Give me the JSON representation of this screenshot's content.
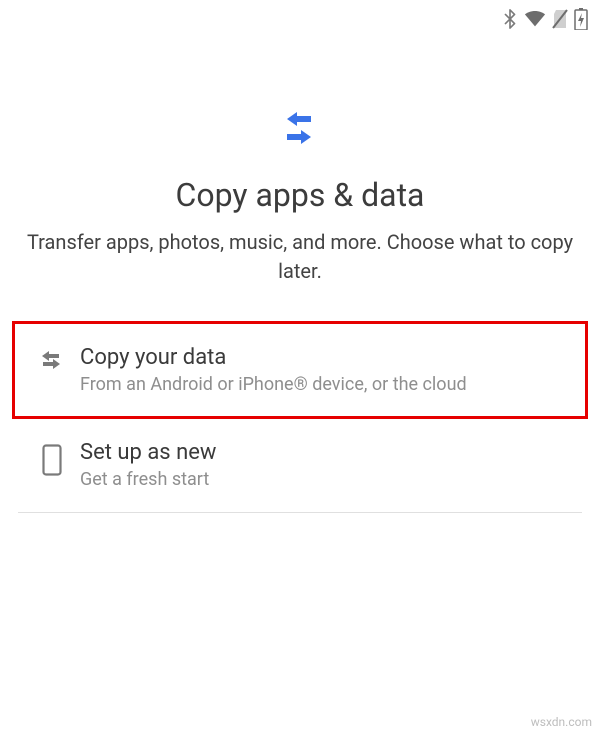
{
  "status_icons": {
    "bluetooth": "bluetooth-icon",
    "wifi": "wifi-icon",
    "no_sim": "no-sim-icon",
    "battery": "battery-charging-icon"
  },
  "hero": {
    "title": "Copy apps & data",
    "subtitle": "Transfer apps, photos, music, and more. Choose what to copy later."
  },
  "options": [
    {
      "id": "copy",
      "title": "Copy your data",
      "subtitle": "From an Android or iPhone® device, or the cloud",
      "highlighted": true,
      "icon": "transfer-icon"
    },
    {
      "id": "new",
      "title": "Set up as new",
      "subtitle": "Get a fresh start",
      "highlighted": false,
      "icon": "phone-outline-icon"
    }
  ],
  "watermark": "wsxdn.com",
  "colors": {
    "accent": "#3a73e8",
    "highlight_border": "#e60000",
    "text_primary": "#3c3c3c",
    "text_secondary": "#8e8e8e"
  }
}
